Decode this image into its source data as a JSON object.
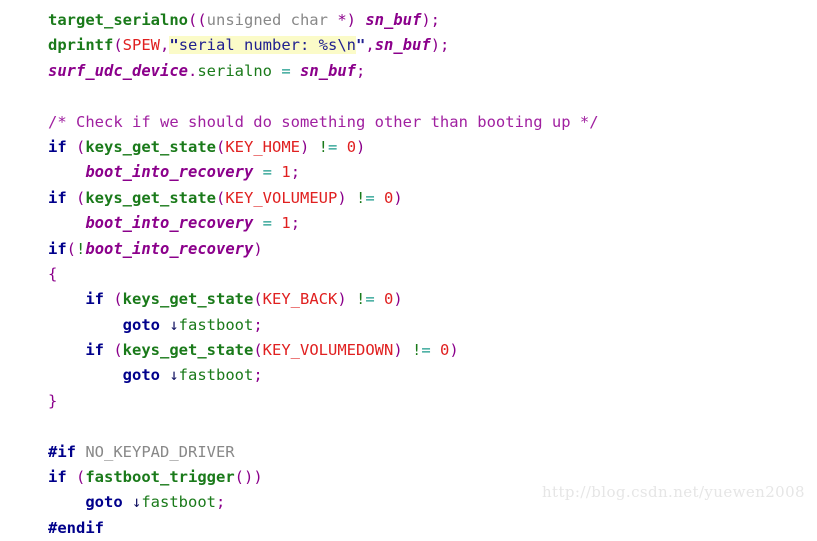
{
  "editor": {
    "background_color": "#ffffff",
    "highlight_color": "#fbfbc8",
    "language": "C",
    "colors": {
      "function": "#1a7a1a",
      "identifier": "#1a7a1a",
      "keyword": "#00008b",
      "punctuation": "#8b008b",
      "variable": "#8b008b",
      "constant": "#e02020",
      "number": "#e02020",
      "operator": "#1a9a8a",
      "string": "#202090",
      "comment": "#a020a0",
      "preprocessor": "#00008b",
      "type": "#888888",
      "watermark": "#e6e6e6"
    }
  },
  "code": {
    "lines": [
      {
        "n": 1,
        "tokens": [
          {
            "c": "t-func",
            "t": "target_serialno"
          },
          {
            "c": "t-punc",
            "t": "(("
          },
          {
            "c": "t-type",
            "t": "unsigned char "
          },
          {
            "c": "t-punc",
            "t": "*) "
          },
          {
            "c": "t-var",
            "t": "sn_buf"
          },
          {
            "c": "t-punc",
            "t": ");"
          }
        ]
      },
      {
        "n": 2,
        "tokens": [
          {
            "c": "t-func",
            "t": "dprintf"
          },
          {
            "c": "t-punc",
            "t": "("
          },
          {
            "c": "t-const",
            "t": "SPEW"
          },
          {
            "c": "t-punc",
            "t": ","
          },
          {
            "c": "t-strq hl",
            "t": "\""
          },
          {
            "c": "t-str hl",
            "t": "serial number: %s\\n"
          },
          {
            "c": "t-strq",
            "t": "\""
          },
          {
            "c": "t-punc",
            "t": ","
          },
          {
            "c": "t-var",
            "t": "sn_buf"
          },
          {
            "c": "t-punc",
            "t": ");"
          }
        ]
      },
      {
        "n": 3,
        "tokens": [
          {
            "c": "t-var",
            "t": "surf_udc_device"
          },
          {
            "c": "t-punc",
            "t": "."
          },
          {
            "c": "t-ident",
            "t": "serialno"
          },
          {
            "c": "t-punc",
            "t": " "
          },
          {
            "c": "t-op",
            "t": "="
          },
          {
            "c": "t-punc",
            "t": " "
          },
          {
            "c": "t-var",
            "t": "sn_buf"
          },
          {
            "c": "t-punc",
            "t": ";"
          }
        ]
      },
      {
        "n": 4,
        "tokens": []
      },
      {
        "n": 5,
        "tokens": [
          {
            "c": "t-comment",
            "t": "/* Check if we should do something other than booting up */"
          }
        ]
      },
      {
        "n": 6,
        "tokens": [
          {
            "c": "t-kw",
            "t": "if"
          },
          {
            "c": "t-punc",
            "t": " ("
          },
          {
            "c": "t-func",
            "t": "keys_get_state"
          },
          {
            "c": "t-punc",
            "t": "("
          },
          {
            "c": "t-const",
            "t": "KEY_HOME"
          },
          {
            "c": "t-punc",
            "t": ") "
          },
          {
            "c": "t-bang",
            "t": "!"
          },
          {
            "c": "t-op",
            "t": "="
          },
          {
            "c": "t-punc",
            "t": " "
          },
          {
            "c": "t-num",
            "t": "0"
          },
          {
            "c": "t-punc",
            "t": ")"
          }
        ]
      },
      {
        "n": 7,
        "tokens": [
          {
            "c": "t-punc",
            "t": "    "
          },
          {
            "c": "t-var",
            "t": "boot_into_recovery"
          },
          {
            "c": "t-punc",
            "t": " "
          },
          {
            "c": "t-op",
            "t": "="
          },
          {
            "c": "t-punc",
            "t": " "
          },
          {
            "c": "t-num",
            "t": "1"
          },
          {
            "c": "t-punc",
            "t": ";"
          }
        ]
      },
      {
        "n": 8,
        "tokens": [
          {
            "c": "t-kw",
            "t": "if"
          },
          {
            "c": "t-punc",
            "t": " ("
          },
          {
            "c": "t-func",
            "t": "keys_get_state"
          },
          {
            "c": "t-punc",
            "t": "("
          },
          {
            "c": "t-const",
            "t": "KEY_VOLUMEUP"
          },
          {
            "c": "t-punc",
            "t": ") "
          },
          {
            "c": "t-bang",
            "t": "!"
          },
          {
            "c": "t-op",
            "t": "="
          },
          {
            "c": "t-punc",
            "t": " "
          },
          {
            "c": "t-num",
            "t": "0"
          },
          {
            "c": "t-punc",
            "t": ")"
          }
        ]
      },
      {
        "n": 9,
        "tokens": [
          {
            "c": "t-punc",
            "t": "    "
          },
          {
            "c": "t-var",
            "t": "boot_into_recovery"
          },
          {
            "c": "t-punc",
            "t": " "
          },
          {
            "c": "t-op",
            "t": "="
          },
          {
            "c": "t-punc",
            "t": " "
          },
          {
            "c": "t-num",
            "t": "1"
          },
          {
            "c": "t-punc",
            "t": ";"
          }
        ]
      },
      {
        "n": 10,
        "tokens": [
          {
            "c": "t-kw",
            "t": "if"
          },
          {
            "c": "t-punc",
            "t": "("
          },
          {
            "c": "t-bang",
            "t": "!"
          },
          {
            "c": "t-var",
            "t": "boot_into_recovery"
          },
          {
            "c": "t-punc",
            "t": ")"
          }
        ]
      },
      {
        "n": 11,
        "tokens": [
          {
            "c": "t-punc",
            "t": "{"
          }
        ]
      },
      {
        "n": 12,
        "tokens": [
          {
            "c": "t-punc",
            "t": "    "
          },
          {
            "c": "t-kw",
            "t": "if"
          },
          {
            "c": "t-punc",
            "t": " ("
          },
          {
            "c": "t-func",
            "t": "keys_get_state"
          },
          {
            "c": "t-punc",
            "t": "("
          },
          {
            "c": "t-const",
            "t": "KEY_BACK"
          },
          {
            "c": "t-punc",
            "t": ") "
          },
          {
            "c": "t-bang",
            "t": "!"
          },
          {
            "c": "t-op",
            "t": "="
          },
          {
            "c": "t-punc",
            "t": " "
          },
          {
            "c": "t-num",
            "t": "0"
          },
          {
            "c": "t-punc",
            "t": ")"
          }
        ]
      },
      {
        "n": 13,
        "tokens": [
          {
            "c": "t-punc",
            "t": "        "
          },
          {
            "c": "t-kw",
            "t": "goto"
          },
          {
            "c": "t-punc",
            "t": " "
          },
          {
            "c": "t-arrow",
            "t": "↓"
          },
          {
            "c": "t-ident",
            "t": "fastboot"
          },
          {
            "c": "t-punc",
            "t": ";"
          }
        ]
      },
      {
        "n": 14,
        "tokens": [
          {
            "c": "t-punc",
            "t": "    "
          },
          {
            "c": "t-kw",
            "t": "if"
          },
          {
            "c": "t-punc",
            "t": " ("
          },
          {
            "c": "t-func",
            "t": "keys_get_state"
          },
          {
            "c": "t-punc",
            "t": "("
          },
          {
            "c": "t-const",
            "t": "KEY_VOLUMEDOWN"
          },
          {
            "c": "t-punc",
            "t": ") "
          },
          {
            "c": "t-bang",
            "t": "!"
          },
          {
            "c": "t-op",
            "t": "="
          },
          {
            "c": "t-punc",
            "t": " "
          },
          {
            "c": "t-num",
            "t": "0"
          },
          {
            "c": "t-punc",
            "t": ")"
          }
        ]
      },
      {
        "n": 15,
        "tokens": [
          {
            "c": "t-punc",
            "t": "        "
          },
          {
            "c": "t-kw",
            "t": "goto"
          },
          {
            "c": "t-punc",
            "t": " "
          },
          {
            "c": "t-arrow",
            "t": "↓"
          },
          {
            "c": "t-ident",
            "t": "fastboot"
          },
          {
            "c": "t-punc",
            "t": ";"
          }
        ]
      },
      {
        "n": 16,
        "tokens": [
          {
            "c": "t-punc",
            "t": "}"
          }
        ]
      },
      {
        "n": 17,
        "tokens": []
      },
      {
        "n": 18,
        "tokens": [
          {
            "c": "t-pp",
            "t": "#if"
          },
          {
            "c": "t-ppname",
            "t": " NO_KEYPAD_DRIVER"
          }
        ]
      },
      {
        "n": 19,
        "tokens": [
          {
            "c": "t-kw",
            "t": "if"
          },
          {
            "c": "t-punc",
            "t": " ("
          },
          {
            "c": "t-func",
            "t": "fastboot_trigger"
          },
          {
            "c": "t-punc",
            "t": "())"
          }
        ]
      },
      {
        "n": 20,
        "tokens": [
          {
            "c": "t-punc",
            "t": "    "
          },
          {
            "c": "t-kw",
            "t": "goto"
          },
          {
            "c": "t-punc",
            "t": " "
          },
          {
            "c": "t-arrow",
            "t": "↓"
          },
          {
            "c": "t-ident",
            "t": "fastboot"
          },
          {
            "c": "t-punc",
            "t": ";"
          }
        ]
      },
      {
        "n": 21,
        "tokens": [
          {
            "c": "t-pp",
            "t": "#endif"
          }
        ]
      }
    ]
  },
  "watermark": {
    "text": "http://blog.csdn.net/yuewen2008"
  }
}
